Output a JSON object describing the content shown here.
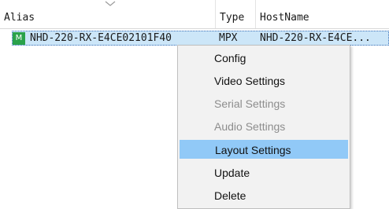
{
  "columns": {
    "alias": "Alias",
    "type": "Type",
    "hostname": "HostName"
  },
  "row": {
    "badge": "M",
    "alias": "NHD-220-RX-E4CE02101F40",
    "type": "MPX",
    "hostname": "NHD-220-RX-E4CE..."
  },
  "menu": {
    "items": [
      {
        "label": "Config",
        "state": "enabled"
      },
      {
        "label": "Video Settings",
        "state": "enabled"
      },
      {
        "label": "Serial Settings",
        "state": "disabled"
      },
      {
        "label": "Audio Settings",
        "state": "disabled"
      },
      {
        "label": "Layout Settings",
        "state": "highlighted"
      },
      {
        "label": "Update",
        "state": "enabled"
      },
      {
        "label": "Delete",
        "state": "enabled"
      }
    ]
  },
  "colors": {
    "badge": "#2aa24a",
    "selection": "#cce6f8",
    "highlight": "#91c9f7"
  },
  "icons": {
    "sort": "chevron-down-icon",
    "badge": "device-badge-icon"
  }
}
